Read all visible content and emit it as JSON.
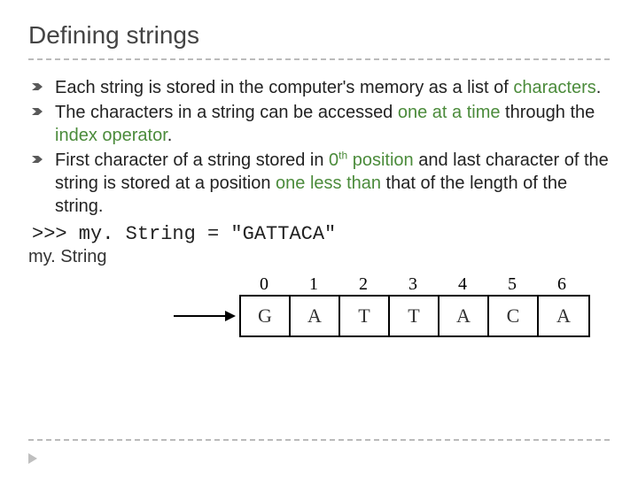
{
  "title": "Defining strings",
  "bullets": [
    {
      "pre": "Each string is stored in the computer's memory as a list of ",
      "hl1": "characters",
      "post1": "."
    },
    {
      "pre": "The characters in a string can be accessed ",
      "hl1": "one at a time",
      "mid": " through the ",
      "hl2": "index operator",
      "post1": "."
    },
    {
      "pre": "First character of a string stored in ",
      "hl1": "0",
      "sup1": "th",
      "mid1": " ",
      "hl2": "position",
      "mid2": " and last character of the string is stored at a position ",
      "hl3": "one less than",
      "post1": " that of the length of the string."
    }
  ],
  "code_line": ">>> my. String = \"GATTACA\"",
  "var_label": "my. String",
  "chart_data": {
    "type": "table",
    "title": "String index diagram",
    "indices": [
      "0",
      "1",
      "2",
      "3",
      "4",
      "5",
      "6"
    ],
    "chars": [
      "G",
      "A",
      "T",
      "T",
      "A",
      "C",
      "A"
    ]
  }
}
